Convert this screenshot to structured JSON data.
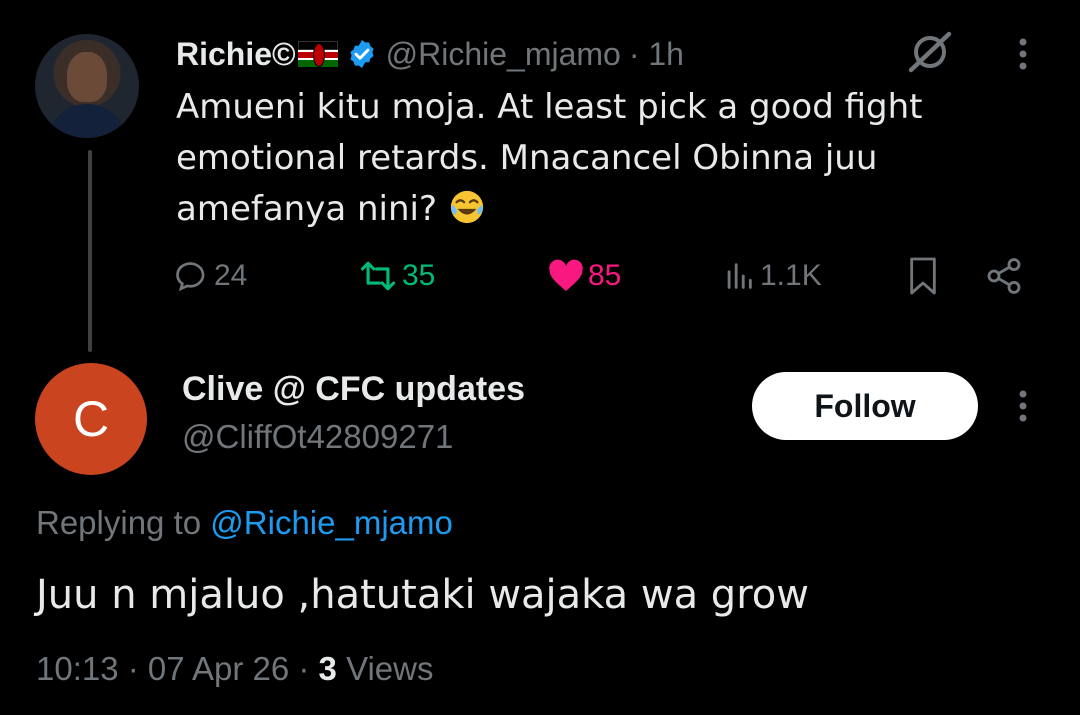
{
  "parent": {
    "name": "Richie©",
    "handle": "@Richie_mjamo",
    "time": "· 1h",
    "text": "Amueni kitu moja. At least pick a good fight emotional retards. Mnacancel Obinna juu amefanya nini?",
    "stats": {
      "replies": "24",
      "retweets": "35",
      "likes": "85",
      "views": "1.1K"
    },
    "colors": {
      "retweet": "#00ba7c",
      "like": "#f91880",
      "verified": "#1d9bf0"
    }
  },
  "reply": {
    "avatar_letter": "C",
    "name": "Clive @ CFC updates",
    "handle": "@CliffOt42809271",
    "follow_label": "Follow",
    "replying_prefix": "Replying to",
    "replying_mention": "@Richie_mjamo",
    "text": "Juu n mjaluo ,hatutaki wajaka wa grow",
    "timestamp": "10:13 · 07 Apr 26 ·",
    "views_count": "3",
    "views_label": "Views",
    "colors": {
      "avatar_bg": "#c9441f",
      "mention": "#1d9bf0"
    }
  }
}
